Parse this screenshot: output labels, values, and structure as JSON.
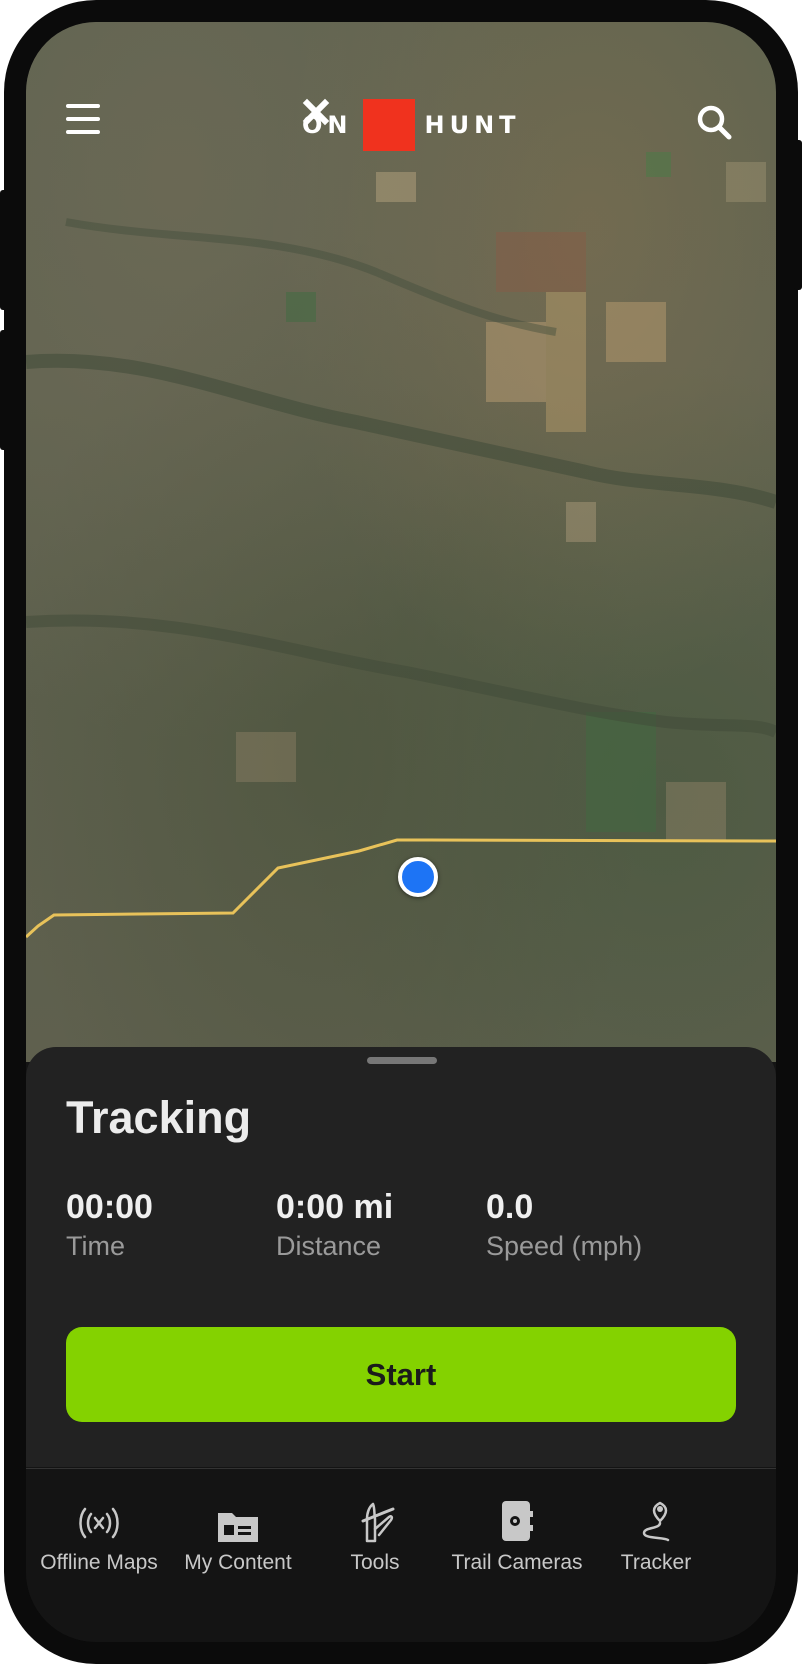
{
  "app": {
    "logo_left": "ON",
    "logo_right": "HUNT",
    "brand_color": "#f0321e",
    "accent_color": "#84d200"
  },
  "header": {
    "menu_icon": "hamburger-menu-icon",
    "search_icon": "search-icon"
  },
  "map": {
    "layer": "satellite",
    "location_marker_color": "#1d74f5",
    "track_color": "#e8c25a"
  },
  "tracking": {
    "title": "Tracking",
    "stats": [
      {
        "value": "00:00",
        "label": "Time"
      },
      {
        "value": "0:00 mi",
        "label": "Distance"
      },
      {
        "value": "0.0",
        "label": "Speed (mph)"
      }
    ],
    "start_label": "Start"
  },
  "bottom_nav": [
    {
      "label": "Offline Maps",
      "icon": "offline-signal-icon"
    },
    {
      "label": "My Content",
      "icon": "folder-icon"
    },
    {
      "label": "Tools",
      "icon": "tools-icon"
    },
    {
      "label": "Trail Cameras",
      "icon": "trail-camera-icon"
    },
    {
      "label": "Tracker",
      "icon": "location-pin-icon"
    }
  ]
}
